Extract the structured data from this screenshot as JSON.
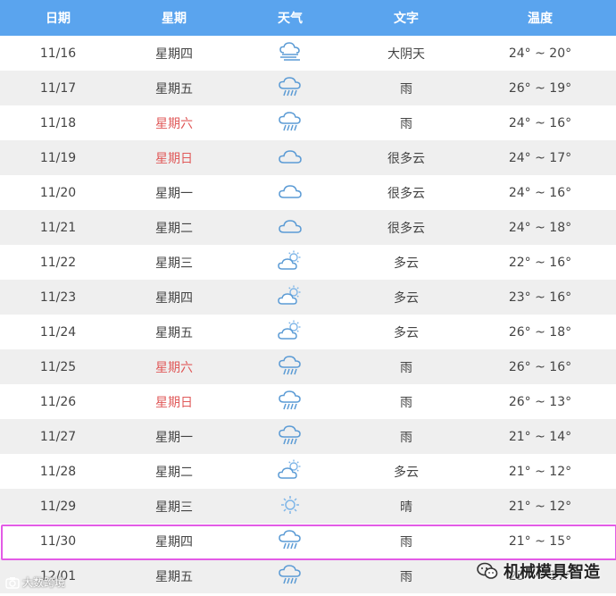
{
  "header": {
    "date": "日期",
    "weekday": "星期",
    "weather": "天气",
    "text": "文字",
    "temp": "温度"
  },
  "colors": {
    "header_bg": "#5aa4ee",
    "row_alt_bg": "#efefef",
    "weekend_text": "#e05a5a",
    "icon_blue": "#5b9bd5",
    "icon_sun": "#7fb6e8",
    "highlight_border": "#e35be6"
  },
  "rows": [
    {
      "date": "11/16",
      "weekday": "星期四",
      "icon": "fog-icon",
      "text": "大阴天",
      "temp": "24° ~ 20°",
      "weekend": false
    },
    {
      "date": "11/17",
      "weekday": "星期五",
      "icon": "rain-icon",
      "text": "雨",
      "temp": "26° ~ 19°",
      "weekend": false
    },
    {
      "date": "11/18",
      "weekday": "星期六",
      "icon": "rain-icon",
      "text": "雨",
      "temp": "24° ~ 16°",
      "weekend": true
    },
    {
      "date": "11/19",
      "weekday": "星期日",
      "icon": "cloud-icon",
      "text": "很多云",
      "temp": "24° ~ 17°",
      "weekend": true
    },
    {
      "date": "11/20",
      "weekday": "星期一",
      "icon": "cloud-icon",
      "text": "很多云",
      "temp": "24° ~ 16°",
      "weekend": false
    },
    {
      "date": "11/21",
      "weekday": "星期二",
      "icon": "cloud-icon",
      "text": "很多云",
      "temp": "24° ~ 18°",
      "weekend": false
    },
    {
      "date": "11/22",
      "weekday": "星期三",
      "icon": "partly-cloudy-icon",
      "text": "多云",
      "temp": "22° ~ 16°",
      "weekend": false
    },
    {
      "date": "11/23",
      "weekday": "星期四",
      "icon": "partly-cloudy-icon",
      "text": "多云",
      "temp": "23° ~ 16°",
      "weekend": false
    },
    {
      "date": "11/24",
      "weekday": "星期五",
      "icon": "partly-cloudy-icon",
      "text": "多云",
      "temp": "26° ~ 18°",
      "weekend": false
    },
    {
      "date": "11/25",
      "weekday": "星期六",
      "icon": "rain-icon",
      "text": "雨",
      "temp": "26° ~ 16°",
      "weekend": true
    },
    {
      "date": "11/26",
      "weekday": "星期日",
      "icon": "rain-icon",
      "text": "雨",
      "temp": "26° ~ 13°",
      "weekend": true
    },
    {
      "date": "11/27",
      "weekday": "星期一",
      "icon": "rain-icon",
      "text": "雨",
      "temp": "21° ~ 14°",
      "weekend": false
    },
    {
      "date": "11/28",
      "weekday": "星期二",
      "icon": "partly-cloudy-icon",
      "text": "多云",
      "temp": "21° ~ 12°",
      "weekend": false
    },
    {
      "date": "11/29",
      "weekday": "星期三",
      "icon": "sun-icon",
      "text": "晴",
      "temp": "21° ~ 12°",
      "weekend": false
    },
    {
      "date": "11/30",
      "weekday": "星期四",
      "icon": "rain-icon",
      "text": "雨",
      "temp": "21° ~ 15°",
      "weekend": false
    },
    {
      "date": "12/01",
      "weekday": "星期五",
      "icon": "rain-icon",
      "text": "雨",
      "temp": "23° ~ 17°",
      "weekend": false
    }
  ],
  "watermark": {
    "left": "大数跨境",
    "right": "机械模具智造"
  }
}
